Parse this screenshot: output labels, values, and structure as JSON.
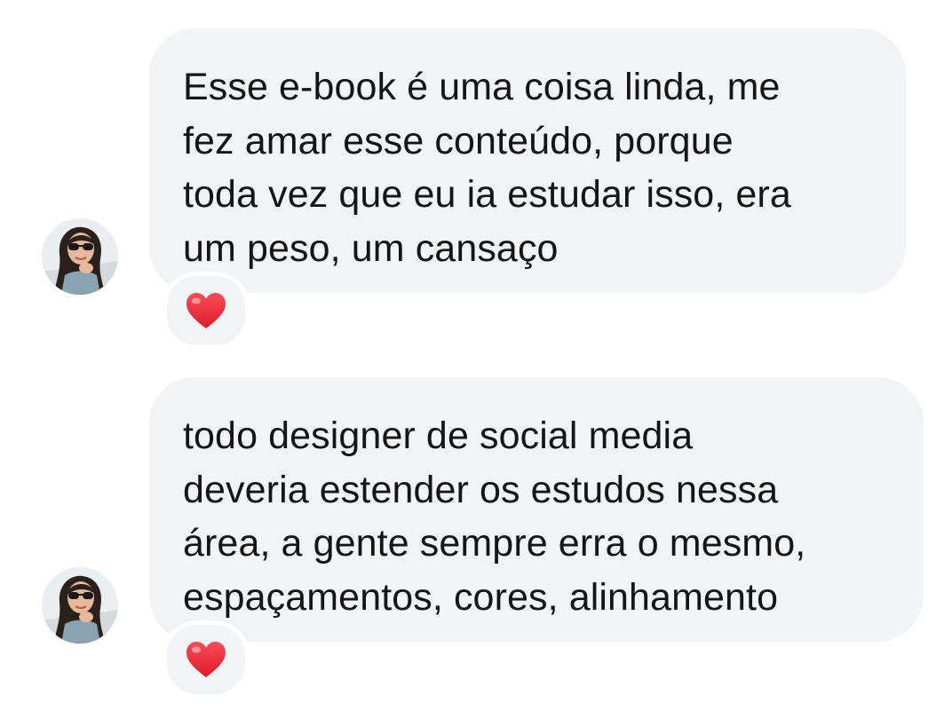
{
  "messages": [
    {
      "text": "Esse e-book é uma coisa linda, me\nfez amar esse conteúdo, porque\ntoda vez que eu ia estudar isso, era\num peso, um cansaço",
      "reaction": "heart",
      "avatar_icon": "user-avatar"
    },
    {
      "text": "todo designer de social media\ndeveria estender os estudos nessa\nárea, a gente sempre erra o mesmo,\nespaçamentos, cores, alinhamento",
      "reaction": "heart",
      "avatar_icon": "user-avatar"
    }
  ],
  "colors": {
    "bubble": "#f2f3f5",
    "text": "#151515",
    "heart": "#e3262f"
  }
}
